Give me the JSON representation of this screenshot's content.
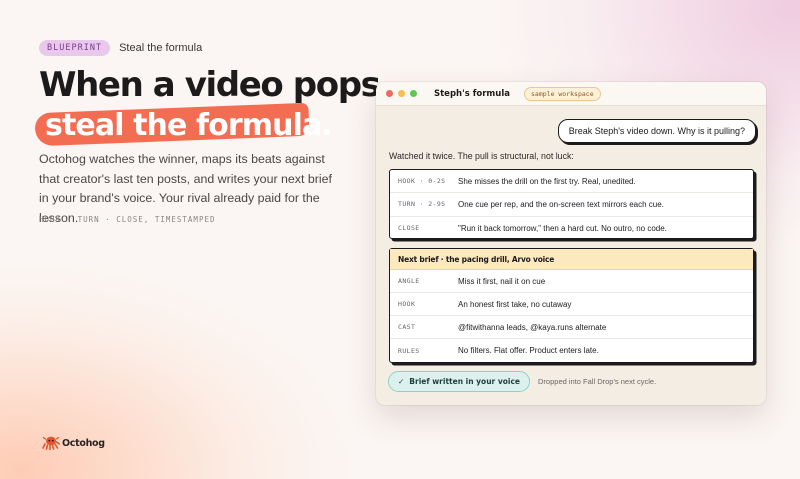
{
  "hero": {
    "badge": "BLUEPRINT",
    "eyebrow": "Steal the formula",
    "headline_line1": "When a video pops,",
    "headline_line2": "steal the formula.",
    "lede": "Octohog watches the winner, maps its beats against that creator's last ten posts, and writes your next brief in your brand's voice. Your rival already paid for the lesson.",
    "tagline": "HOOK · TURN · CLOSE, TIMESTAMPED"
  },
  "brand": {
    "name": "Octohog",
    "icon": "octopus-logo-icon",
    "color": "#e2552f"
  },
  "window": {
    "title": "Steph's formula",
    "workspace_badge": "sample workspace",
    "controls": {
      "close": "#ee6a5f",
      "minimize": "#f5be4f",
      "maximize": "#61c554"
    },
    "user_message": "Break Steph's video down. Why is it pulling?",
    "reply_intro": "Watched it twice. The pull is structural, not luck:",
    "beats": [
      {
        "key": "HOOK · 0-2S",
        "value": "She misses the drill on the first try. Real, unedited."
      },
      {
        "key": "TURN · 2-9S",
        "value": "One cue per rep, and the on-screen text mirrors each cue."
      },
      {
        "key": "CLOSE",
        "value": "\"Run it back tomorrow,\" then a hard cut. No outro, no code."
      }
    ],
    "brief": {
      "header": "Next brief · the pacing drill, Arvo voice",
      "rows": [
        {
          "key": "ANGLE",
          "value": "Miss it first, nail it on cue"
        },
        {
          "key": "HOOK",
          "value": "An honest first take, no cutaway"
        },
        {
          "key": "CAST",
          "value": "@fitwithanna leads, @kaya.runs alternate"
        },
        {
          "key": "RULES",
          "value": "No filters. Flat offer. Product enters late."
        }
      ]
    },
    "status_label": "Brief written in your voice",
    "status_icon": "check-icon",
    "status_note": "Dropped into Fall Drop's next cycle."
  },
  "colors": {
    "accent": "#f26d52",
    "badge_bg": "#e8c9ec",
    "brief_header_bg": "#fde9bf",
    "status_bg": "#dcf1ee"
  }
}
